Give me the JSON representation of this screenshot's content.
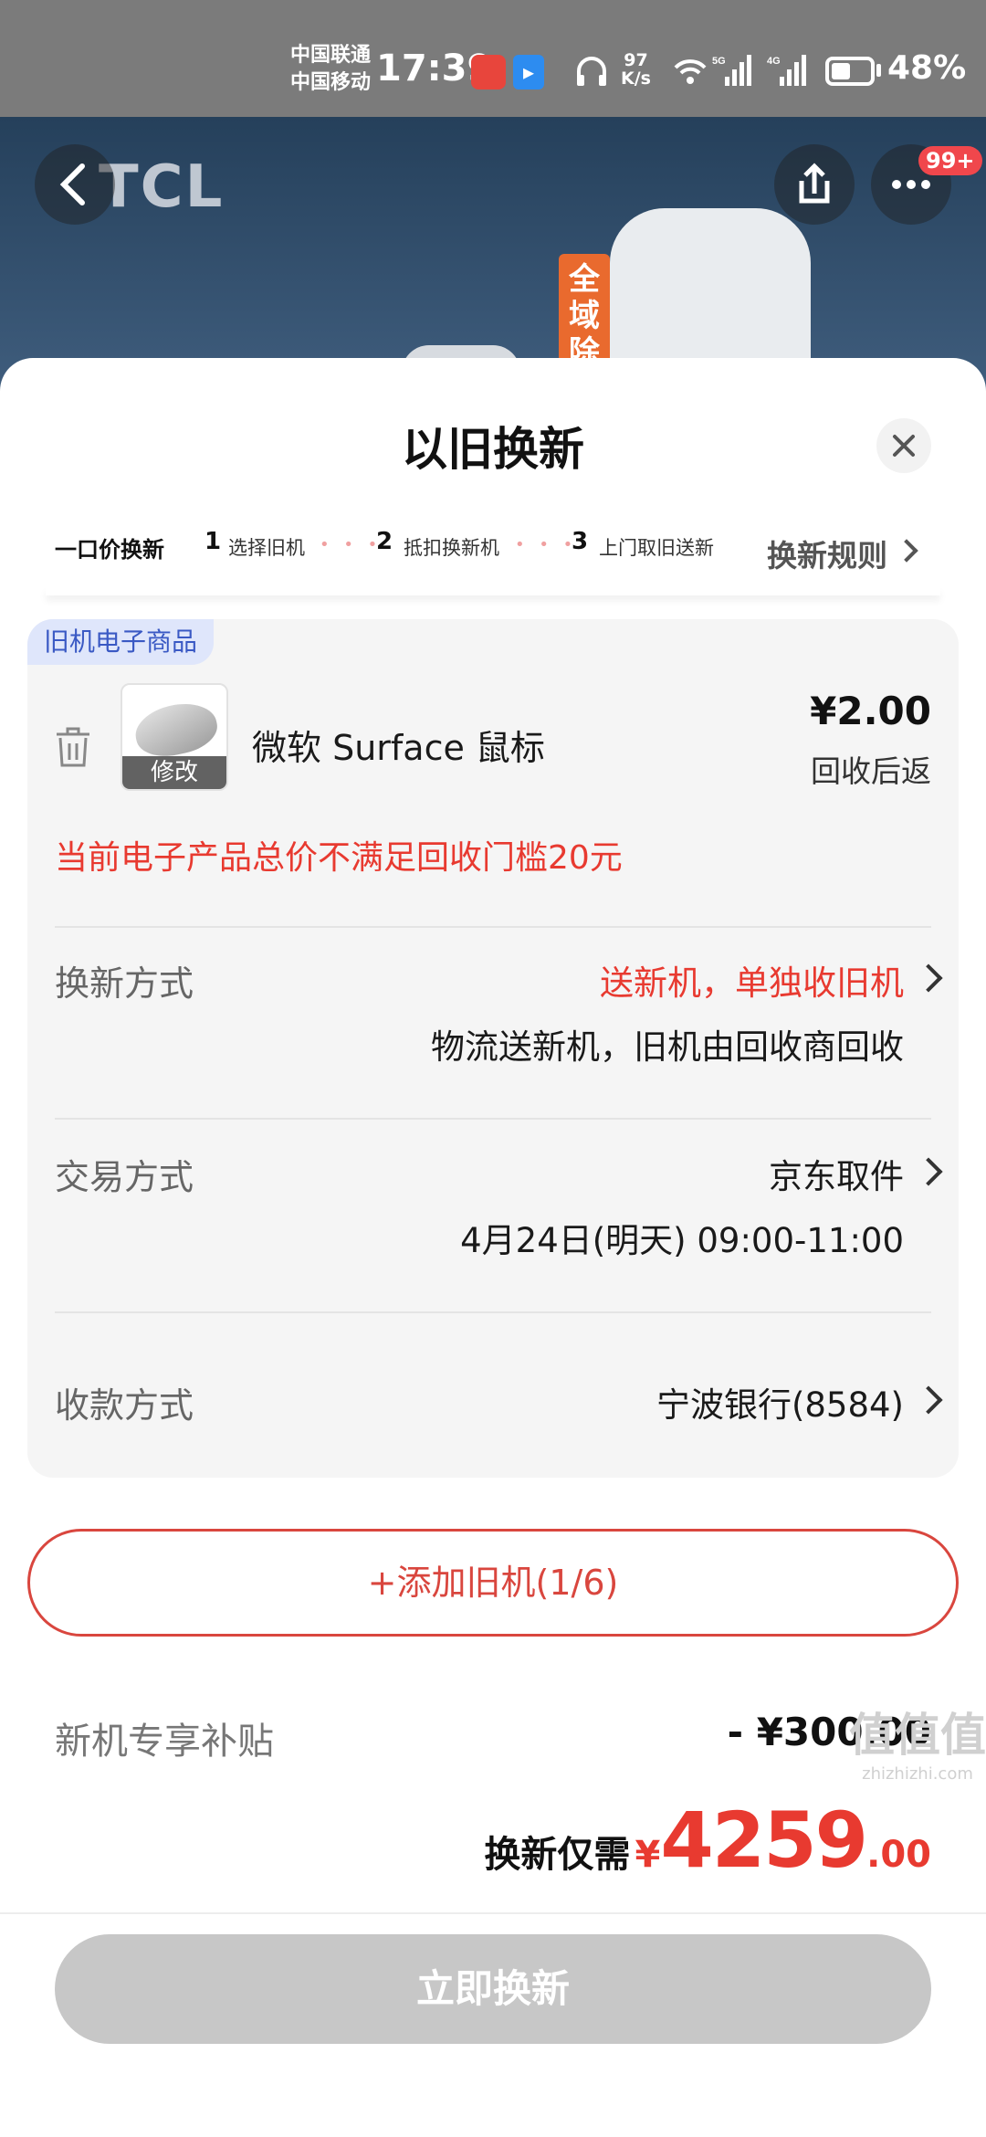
{
  "status_bar": {
    "carrier_1": "中国联通",
    "carrier_2": "中国移动",
    "time": "17:39",
    "speed_value": "97",
    "speed_unit": "K/s",
    "signal_1": "5G",
    "signal_2": "4G",
    "battery": "48%",
    "icons": [
      "weibo-app-icon",
      "blue-app-icon",
      "headphones-icon",
      "wifi-icon",
      "signal-icon",
      "battery-icon"
    ]
  },
  "background": {
    "brand": "TCL",
    "promo_tag": "全域除",
    "badge": "99+"
  },
  "sheet": {
    "title": "以旧换新",
    "steps": {
      "main": "一口价换新",
      "s1_num": "1",
      "s1_label": "选择旧机",
      "s2_num": "2",
      "s2_label": "抵扣换新机",
      "s3_num": "3",
      "s3_label": "上门取旧送新",
      "dots": "• • •",
      "rules": "换新规则"
    },
    "card": {
      "tag": "旧机电子商品",
      "thumb_edit": "修改",
      "product_name": "微软 Surface 鼠标",
      "price": "¥2.00",
      "price_note": "回收后返",
      "warning": "当前电子产品总价不满足回收门槛20元",
      "rows": [
        {
          "label": "换新方式",
          "value": "送新机，单独收旧机",
          "detail": "物流送新机，旧机由回收商回收"
        },
        {
          "label": "交易方式",
          "value": "京东取件",
          "detail": "4月24日(明天) 09:00-11:00"
        },
        {
          "label": "收款方式",
          "value": "宁波银行(8584)"
        }
      ]
    },
    "add_button": "+添加旧机(1/6)",
    "subsidy": {
      "label": "新机专享补贴",
      "value": "- ¥300.00"
    },
    "total": {
      "label": "换新仅需",
      "symbol": "¥",
      "integer": "4259",
      "decimal": ".00"
    },
    "cta": "立即换新"
  },
  "watermark": {
    "main": "值值值",
    "sub": "zhizhizhi.com"
  },
  "colors": {
    "accent_red": "#e83a30",
    "tag_blue": "#3a59c4",
    "cta_disabled": "#c7c7c7"
  }
}
